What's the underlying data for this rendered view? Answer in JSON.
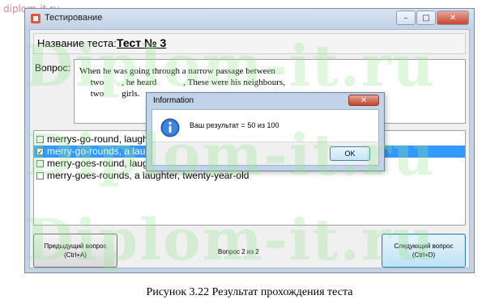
{
  "site_watermark": "diplom-it.ru",
  "big_watermark": "Diplom-it.ru",
  "window": {
    "title": "Тестирование",
    "controls": {
      "minimize": "–",
      "maximize": "□",
      "close": "✕"
    }
  },
  "test": {
    "name_label": "Название теста:",
    "name_value": "Тест № 3"
  },
  "question": {
    "label": "Вопрос:",
    "lines": [
      "When he was going through a narrow passage between",
      "     two        , he heard            , These were his neighbours,",
      "     two        girls."
    ]
  },
  "answers": [
    {
      "text": "merrys-go-round, laughter",
      "checked": false,
      "selected": false
    },
    {
      "text": "merry-go-rounds, a laughter",
      "checked": true,
      "selected": true
    },
    {
      "text": "merry-goes-round, laughter",
      "checked": false,
      "selected": false
    },
    {
      "text": "merry-goes-rounds, a laughter, twenty-year-old",
      "checked": false,
      "selected": false
    }
  ],
  "nav": {
    "prev_line1": "Предыдущий вопрос",
    "prev_line2": "(Ctrl+A)",
    "counter": "Вопрос 2 из 2",
    "next_line1": "Следующий вопрос",
    "next_line2": "(Ctrl+D)"
  },
  "dialog": {
    "title": "Information",
    "close": "✕",
    "message": "Ваш результат = 50 из 100",
    "ok": "OK",
    "icon": "info-icon"
  },
  "caption": "Рисунок 3.22 Результат прохождения теста",
  "colors": {
    "selection": "#3399ff",
    "watermark": "#96e68c"
  }
}
